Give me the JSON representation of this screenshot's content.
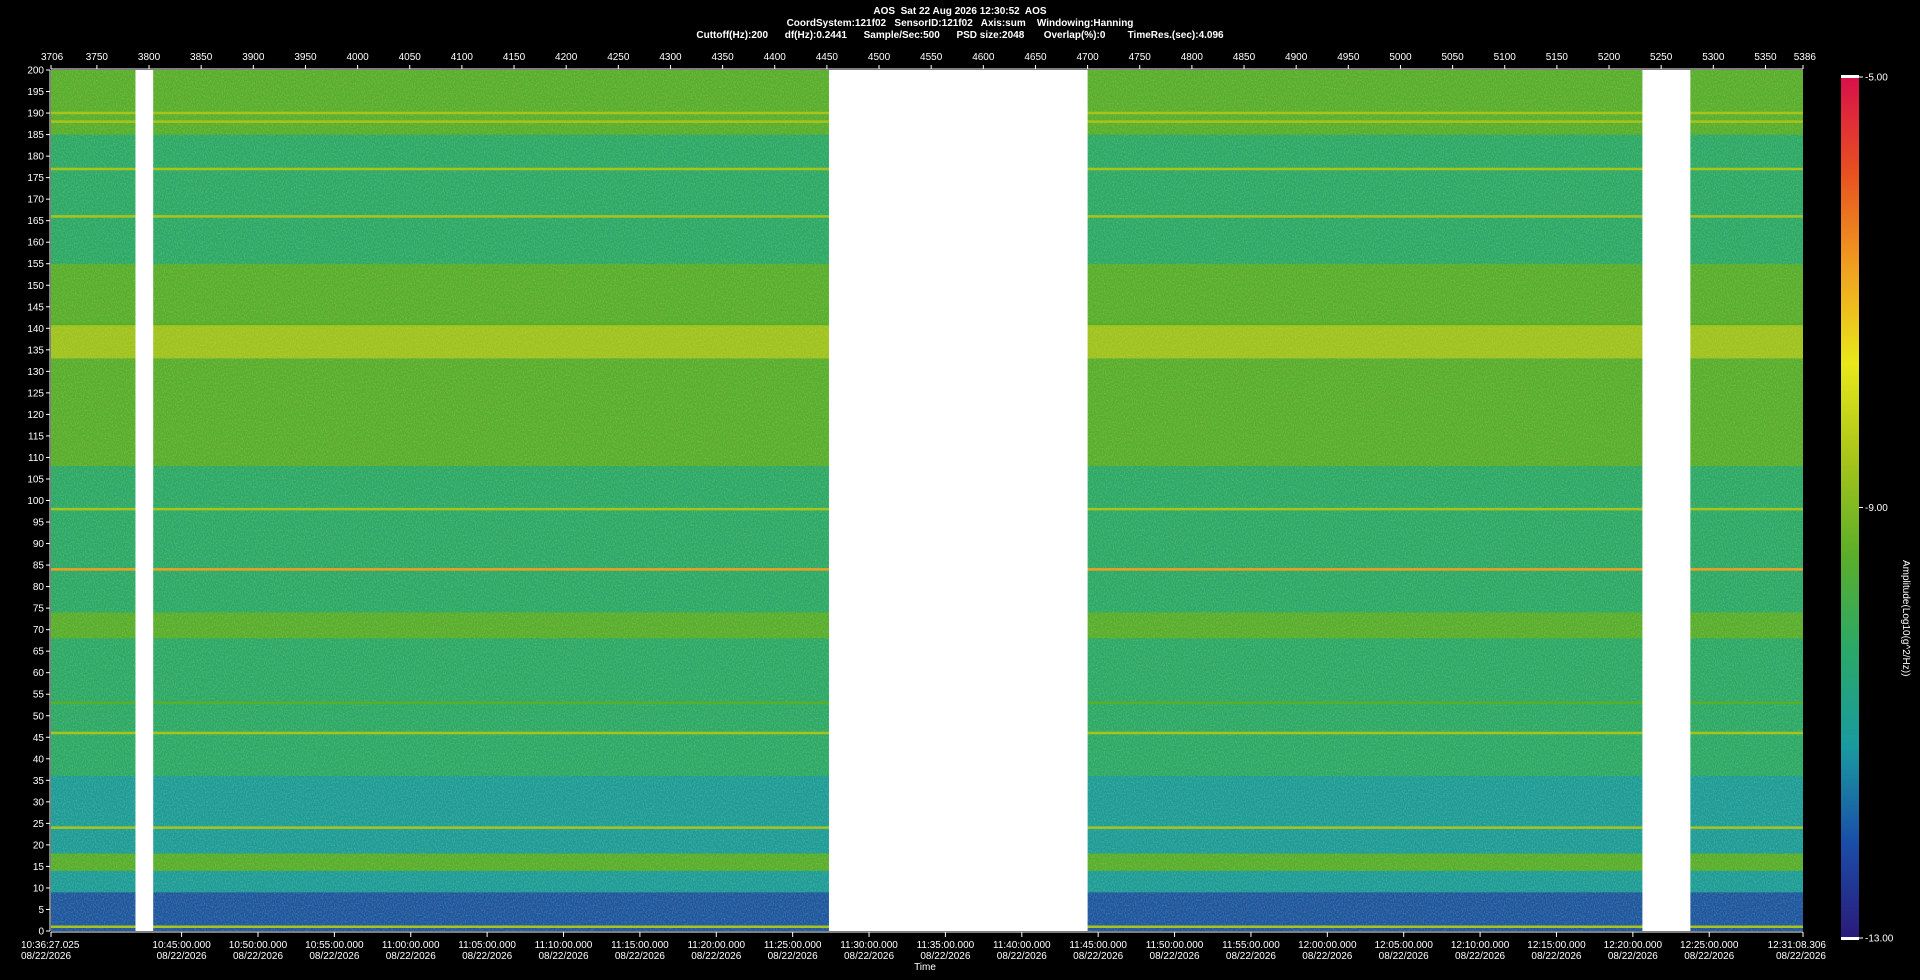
{
  "header": {
    "line1": "AOS  Sat 22 Aug 2026 12:30:52  AOS",
    "line2": "CoordSystem:121f02   SensorID:121f02   Axis:sum    Windowing:Hanning",
    "line3": "Cuttoff(Hz):200      df(Hz):0.2441      Sample/Sec:500      PSD size:2048       Overlap(%):0        TimeRes.(sec):4.096"
  },
  "chart_data": {
    "type": "heatmap",
    "title": "AOS  Sat 22 Aug 2026 12:30:52  AOS",
    "xlabel": "Time",
    "ylabel": "",
    "colorbar_label": "Amplitude(Log10(g^2/Hz))",
    "colorbar_ticks": [
      "-5.00",
      "-9.00",
      "-13.00"
    ],
    "colorbar_range": [
      -13,
      -5
    ],
    "colormap": [
      "#2a1a7a",
      "#1a4ea8",
      "#1a9aa0",
      "#2aa86a",
      "#5aae2a",
      "#a8c41a",
      "#e8e81a",
      "#f0a020",
      "#e85020",
      "#d8104a"
    ],
    "ylim": [
      0,
      200
    ],
    "y_ticks": [
      0,
      5,
      10,
      15,
      20,
      25,
      30,
      35,
      40,
      45,
      50,
      55,
      60,
      65,
      70,
      75,
      80,
      85,
      90,
      95,
      100,
      105,
      110,
      115,
      120,
      125,
      130,
      135,
      140,
      145,
      150,
      155,
      160,
      165,
      170,
      175,
      180,
      185,
      190,
      195,
      200
    ],
    "x_range_seconds": [
      3706,
      5386
    ],
    "top_ticks": [
      "3706",
      "3750",
      "3800",
      "3850",
      "3900",
      "3950",
      "4000",
      "4050",
      "4100",
      "4150",
      "4200",
      "4250",
      "4300",
      "4350",
      "4400",
      "4450",
      "4500",
      "4550",
      "4600",
      "4650",
      "4700",
      "4750",
      "4800",
      "4850",
      "4900",
      "4950",
      "5000",
      "5050",
      "5100",
      "5150",
      "5200",
      "5250",
      "5300",
      "5350",
      "5386"
    ],
    "bottom_ticks": [
      {
        "time": "10:36:27.025",
        "date": "08/22/2026"
      },
      {
        "time": "10:45:00.000",
        "date": "08/22/2026"
      },
      {
        "time": "10:50:00.000",
        "date": "08/22/2026"
      },
      {
        "time": "10:55:00.000",
        "date": "08/22/2026"
      },
      {
        "time": "11:00:00.000",
        "date": "08/22/2026"
      },
      {
        "time": "11:05:00.000",
        "date": "08/22/2026"
      },
      {
        "time": "11:10:00.000",
        "date": "08/22/2026"
      },
      {
        "time": "11:15:00.000",
        "date": "08/22/2026"
      },
      {
        "time": "11:20:00.000",
        "date": "08/22/2026"
      },
      {
        "time": "11:25:00.000",
        "date": "08/22/2026"
      },
      {
        "time": "11:30:00.000",
        "date": "08/22/2026"
      },
      {
        "time": "11:35:00.000",
        "date": "08/22/2026"
      },
      {
        "time": "11:40:00.000",
        "date": "08/22/2026"
      },
      {
        "time": "11:45:00.000",
        "date": "08/22/2026"
      },
      {
        "time": "11:50:00.000",
        "date": "08/22/2026"
      },
      {
        "time": "11:55:00.000",
        "date": "08/22/2026"
      },
      {
        "time": "12:00:00.000",
        "date": "08/22/2026"
      },
      {
        "time": "12:05:00.000",
        "date": "08/22/2026"
      },
      {
        "time": "12:10:00.000",
        "date": "08/22/2026"
      },
      {
        "time": "12:15:00.000",
        "date": "08/22/2026"
      },
      {
        "time": "12:20:00.000",
        "date": "08/22/2026"
      },
      {
        "time": "12:25:00.000",
        "date": "08/22/2026"
      },
      {
        "time": "12:31:08.306",
        "date": "08/22/2026"
      }
    ],
    "data_gaps_seconds": [
      [
        3787,
        3804
      ],
      [
        4452,
        4700
      ],
      [
        5232,
        5278
      ]
    ],
    "tonal_lines_hz": [
      {
        "hz": 1,
        "level": -9.0
      },
      {
        "hz": 24,
        "level": -9.0
      },
      {
        "hz": 46,
        "level": -8.8
      },
      {
        "hz": 53,
        "level": -9.2
      },
      {
        "hz": 84,
        "level": -7.0
      },
      {
        "hz": 98,
        "level": -8.5
      },
      {
        "hz": 141,
        "level": -9.2
      },
      {
        "hz": 166,
        "level": -8.8
      },
      {
        "hz": 177,
        "level": -8.8
      },
      {
        "hz": 188,
        "level": -8.8
      },
      {
        "hz": 190,
        "level": -8.8
      }
    ],
    "bands_hz": [
      {
        "hz": [
          0,
          9
        ],
        "level": -12.0
      },
      {
        "hz": [
          9,
          14
        ],
        "level": -11.0
      },
      {
        "hz": [
          14,
          18
        ],
        "level": -9.6
      },
      {
        "hz": [
          18,
          36
        ],
        "level": -10.8
      },
      {
        "hz": [
          36,
          45
        ],
        "level": -10.2
      },
      {
        "hz": [
          45,
          68
        ],
        "level": -10.0
      },
      {
        "hz": [
          68,
          74
        ],
        "level": -9.5
      },
      {
        "hz": [
          74,
          82
        ],
        "level": -10.2
      },
      {
        "hz": [
          82,
          95
        ],
        "level": -9.9
      },
      {
        "hz": [
          95,
          108
        ],
        "level": -10.3
      },
      {
        "hz": [
          108,
          120
        ],
        "level": -9.3
      },
      {
        "hz": [
          120,
          133
        ],
        "level": -9.7
      },
      {
        "hz": [
          133,
          141
        ],
        "level": -8.7
      },
      {
        "hz": [
          141,
          155
        ],
        "level": -9.6
      },
      {
        "hz": [
          155,
          170
        ],
        "level": -9.9
      },
      {
        "hz": [
          170,
          185
        ],
        "level": -10.1
      },
      {
        "hz": [
          185,
          200
        ],
        "level": -9.8
      }
    ]
  },
  "axis": {
    "x_title": "Time"
  }
}
